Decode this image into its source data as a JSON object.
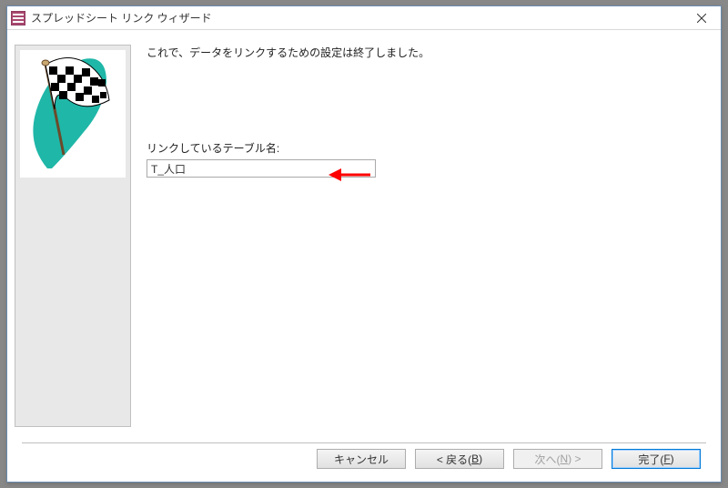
{
  "titlebar": {
    "title": "スプレッドシート リンク ウィザード",
    "close_label": "×"
  },
  "main": {
    "completion_message": "これで、データをリンクするための設定は終了しました。",
    "table_name_label": "リンクしているテーブル名:",
    "table_name_value": "T_人口"
  },
  "buttons": {
    "cancel": "キャンセル",
    "back_prefix": "< 戻る(",
    "back_key": "B",
    "back_suffix": ")",
    "next_prefix": "次へ(",
    "next_key": "N",
    "next_suffix": ") >",
    "finish_prefix": "完了(",
    "finish_key": "F",
    "finish_suffix": ")"
  }
}
